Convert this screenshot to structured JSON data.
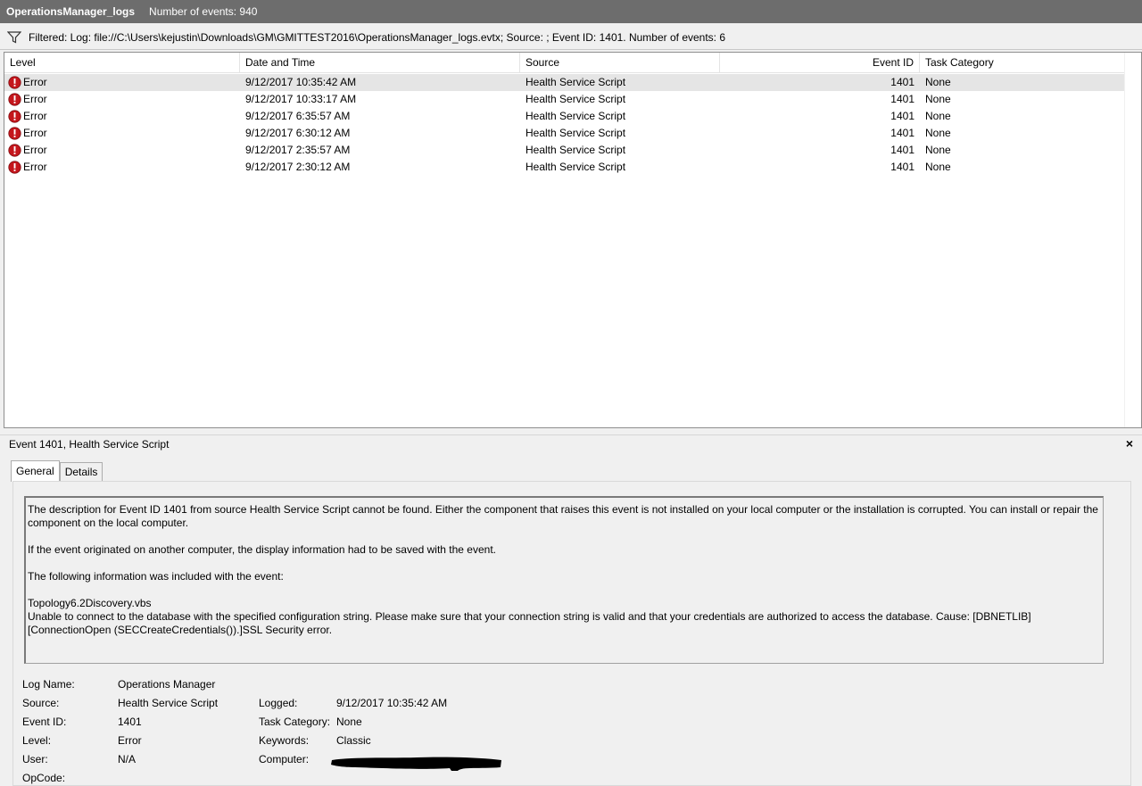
{
  "titlebar": {
    "log_name": "OperationsManager_logs",
    "event_count": "Number of events: 940"
  },
  "filter": {
    "icon": "filter-icon",
    "text": "Filtered: Log: file://C:\\Users\\kejustin\\Downloads\\GM\\GMITTEST2016\\OperationsManager_logs.evtx; Source: ; Event ID: 1401. Number of events: 6"
  },
  "grid": {
    "columns": [
      "Level",
      "Date and Time",
      "Source",
      "Event ID",
      "Task Category"
    ],
    "rows": [
      {
        "level": "Error",
        "date": "9/12/2017 10:35:42 AM",
        "source": "Health Service Script",
        "event_id": "1401",
        "task": "None"
      },
      {
        "level": "Error",
        "date": "9/12/2017 10:33:17 AM",
        "source": "Health Service Script",
        "event_id": "1401",
        "task": "None"
      },
      {
        "level": "Error",
        "date": "9/12/2017 6:35:57 AM",
        "source": "Health Service Script",
        "event_id": "1401",
        "task": "None"
      },
      {
        "level": "Error",
        "date": "9/12/2017 6:30:12 AM",
        "source": "Health Service Script",
        "event_id": "1401",
        "task": "None"
      },
      {
        "level": "Error",
        "date": "9/12/2017 2:35:57 AM",
        "source": "Health Service Script",
        "event_id": "1401",
        "task": "None"
      },
      {
        "level": "Error",
        "date": "9/12/2017 2:30:12 AM",
        "source": "Health Service Script",
        "event_id": "1401",
        "task": "None"
      }
    ]
  },
  "detail": {
    "header": "Event 1401, Health Service Script",
    "close": "×",
    "tabs": [
      "General",
      "Details"
    ],
    "description": {
      "p1": "The description for Event ID 1401 from source Health Service Script cannot be found. Either the component that raises this event is not installed on your local computer or the installation is corrupted. You can install or repair the component on the local computer.",
      "p2": "If the event originated on another computer, the display information had to be saved with the event.",
      "p3": "The following information was included with the event:",
      "p4_line1": "Topology6.2Discovery.vbs",
      "p4_line2": "Unable to connect to the database with the specified configuration string. Please make sure that your connection string is valid and that your credentials are authorized to access the database. Cause: [DBNETLIB][ConnectionOpen (SECCreateCredentials()).]SSL Security error."
    },
    "fields": {
      "log_name_label": "Log Name:",
      "log_name_value": "Operations Manager",
      "source_label": "Source:",
      "source_value": "Health Service Script",
      "logged_label": "Logged:",
      "logged_value": "9/12/2017 10:35:42 AM",
      "event_id_label": "Event ID:",
      "event_id_value": "1401",
      "task_label": "Task Category:",
      "task_value": "None",
      "level_label": "Level:",
      "level_value": "Error",
      "keywords_label": "Keywords:",
      "keywords_value": "Classic",
      "user_label": "User:",
      "user_value": "N/A",
      "computer_label": "Computer:",
      "opcode_label": "OpCode:"
    }
  },
  "colors": {
    "titlebar_bg": "#6d6d6d",
    "error_icon": "#c4161c",
    "selected_row": "#e5e5e5"
  }
}
